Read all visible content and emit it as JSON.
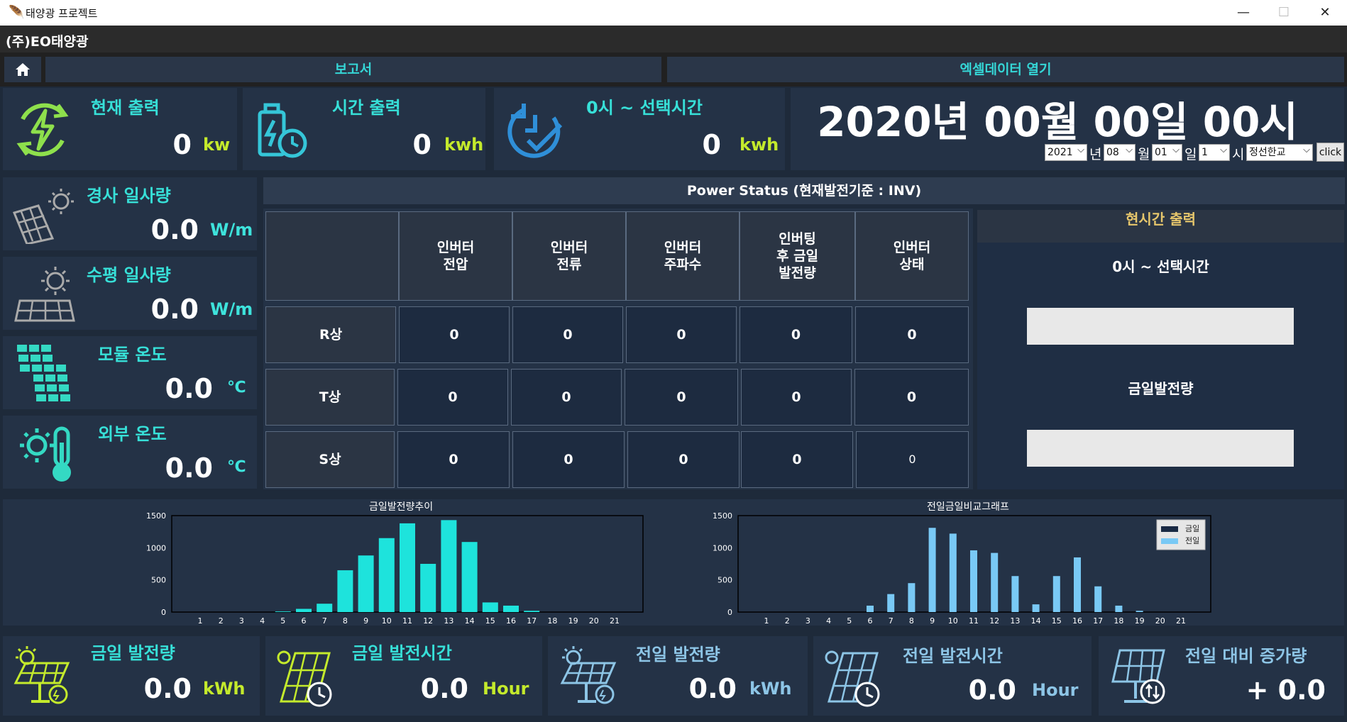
{
  "window": {
    "title": "태양광 프로젝트",
    "minimize": "—",
    "maximize": "☐",
    "close": "✕"
  },
  "company": "(주)EO태양광",
  "nav": {
    "home_icon": "home-icon",
    "report": "보고서",
    "excel": "엑셀데이터 열기"
  },
  "top_cards": [
    {
      "title": "현재 출력",
      "value": "0",
      "unit": "kw",
      "icon": "power-cycle-icon"
    },
    {
      "title": "시간 출력",
      "value": "0",
      "unit": "kwh",
      "icon": "battery-clock-icon"
    },
    {
      "title": "0시 ~ 선택시간",
      "value": "0",
      "unit": "kwh",
      "icon": "refresh-check-icon"
    }
  ],
  "datetime": {
    "display": "2020년 00월 00일 00시"
  },
  "date_selectors": {
    "year": "2021",
    "year_label": "년",
    "month": "08",
    "month_label": "월",
    "day": "01",
    "day_label": "일",
    "hour": "1",
    "hour_label": "시",
    "site": "정선한교",
    "click_button": "click"
  },
  "side_cards": [
    {
      "title": "경사 일사량",
      "value": "0.0",
      "unit": "W/m",
      "icon": "tilted-panel-sun-icon"
    },
    {
      "title": "수평 일사량",
      "value": "0.0",
      "unit": "W/m",
      "icon": "flat-panel-sun-icon"
    },
    {
      "title": "모듈 온도",
      "value": "0.0",
      "unit": "℃",
      "icon": "solar-module-icon"
    },
    {
      "title": "외부 온도",
      "value": "0.0",
      "unit": "℃",
      "icon": "sun-thermometer-icon"
    }
  ],
  "power_status": {
    "header": "Power Status (현재발전기준 : INV)",
    "columns": [
      "인버터\n전압",
      "인버터\n전류",
      "인버터\n주파수",
      "인버팅\n후 금일\n발전량",
      "인버터\n상태"
    ],
    "rows": [
      {
        "label": "R상",
        "values": [
          "0",
          "0",
          "0",
          "0",
          "0"
        ]
      },
      {
        "label": "T상",
        "values": [
          "0",
          "0",
          "0",
          "0",
          "0"
        ]
      },
      {
        "label": "S상",
        "values": [
          "0",
          "0",
          "0",
          "0",
          "0"
        ]
      }
    ]
  },
  "realtime": {
    "header": "현시간 출력",
    "label1": "0시 ~ 선택시간",
    "label2": "금일발전량"
  },
  "chart_data": [
    {
      "type": "bar",
      "title": "금일발전량추이",
      "categories": [
        "1",
        "2",
        "3",
        "4",
        "5",
        "6",
        "7",
        "8",
        "9",
        "10",
        "11",
        "12",
        "13",
        "14",
        "15",
        "16",
        "17",
        "18",
        "19",
        "20",
        "21"
      ],
      "values": [
        0,
        0,
        0,
        0,
        10,
        50,
        130,
        650,
        880,
        1150,
        1380,
        750,
        1430,
        1090,
        150,
        100,
        20,
        0,
        0,
        0,
        0
      ],
      "ylim": [
        0,
        1500
      ],
      "yticks": [
        "0",
        "500",
        "1000",
        "1500"
      ],
      "colors": {
        "bar": "#1ee3dc"
      }
    },
    {
      "type": "bar",
      "title": "전일금일비교그래프",
      "categories": [
        "1",
        "2",
        "3",
        "4",
        "5",
        "6",
        "7",
        "8",
        "9",
        "10",
        "11",
        "12",
        "13",
        "14",
        "15",
        "16",
        "17",
        "18",
        "19",
        "20",
        "21"
      ],
      "series": [
        {
          "name": "금일",
          "values": [
            0,
            0,
            0,
            0,
            0,
            0,
            0,
            0,
            0,
            0,
            0,
            0,
            0,
            0,
            0,
            0,
            0,
            0,
            0,
            0,
            0
          ]
        },
        {
          "name": "전일",
          "values": [
            0,
            0,
            0,
            0,
            0,
            100,
            280,
            450,
            1310,
            1220,
            960,
            920,
            560,
            120,
            560,
            850,
            400,
            100,
            20,
            0,
            0
          ]
        }
      ],
      "ylim": [
        0,
        1500
      ],
      "yticks": [
        "0",
        "500",
        "1000",
        "1500"
      ],
      "legend": "top-right",
      "colors": {
        "금일": "#1a2a44",
        "전일": "#79c9f5"
      }
    }
  ],
  "bottom_cards": [
    {
      "title": "금일 발전량",
      "value": "0.0",
      "unit": "kWh",
      "icon": "solar-panel-gear-icon"
    },
    {
      "title": "금일 발전시간",
      "value": "0.0",
      "unit": "Hour",
      "icon": "solar-panel-clock-icon"
    },
    {
      "title": "전일 발전량",
      "value": "0.0",
      "unit": "kWh",
      "icon": "solar-panel-gear-icon"
    },
    {
      "title": "전일 발전시간",
      "value": "0.0",
      "unit": "Hour",
      "icon": "solar-panel-clock-icon"
    },
    {
      "title": "전일 대비 증가량",
      "value": "+ 0.0",
      "unit": "",
      "icon": "solar-panel-updown-icon"
    }
  ]
}
